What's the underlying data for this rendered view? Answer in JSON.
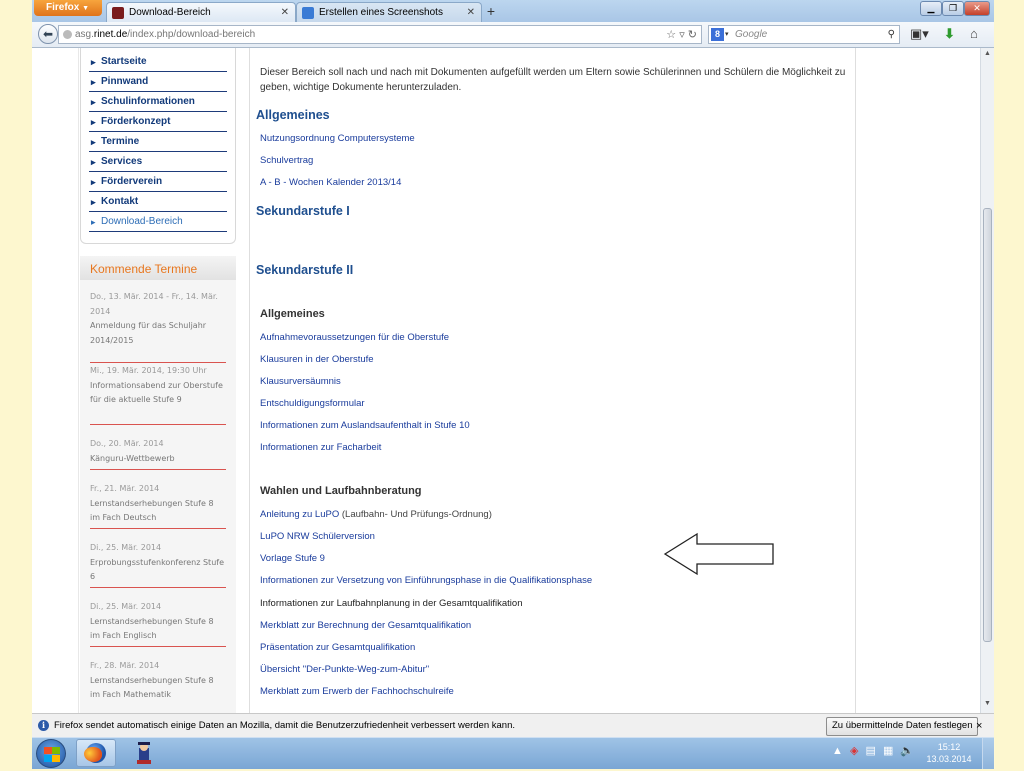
{
  "browser": {
    "app_button": "Firefox",
    "tabs": [
      {
        "label": "Download-Bereich",
        "active": true
      },
      {
        "label": "Erstellen eines Screenshots",
        "active": false
      }
    ],
    "new_tab": "+",
    "url_domain": "asg.rinet.de",
    "url_path": "/index.php/download-bereich",
    "url_prefix": "asg.",
    "url_host": "rinet.de",
    "search_placeholder": "Google",
    "search_engine_letter": "8"
  },
  "sidebar": {
    "menu": [
      {
        "label": "Startseite"
      },
      {
        "label": "Pinnwand"
      },
      {
        "label": "Schulinformationen"
      },
      {
        "label": "Förderkonzept"
      },
      {
        "label": "Termine"
      },
      {
        "label": "Services"
      },
      {
        "label": "Förderverein"
      },
      {
        "label": "Kontakt"
      },
      {
        "label": "Download-Bereich",
        "active": true
      }
    ],
    "events_title": "Kommende Termine",
    "events": [
      {
        "date": "Do., 13. Mär. 2014 - Fr., 14. Mär. 2014",
        "title": "Anmeldung für das Schuljahr 2014/2015"
      },
      {
        "date": "Mi., 19. Mär. 2014, 19:30 Uhr",
        "title": "Informationsabend zur Oberstufe für die aktuelle Stufe 9"
      },
      {
        "date": "Do., 20. Mär. 2014",
        "title": "Känguru-Wettbewerb"
      },
      {
        "date": "Fr., 21. Mär. 2014",
        "title": "Lernstandserhebungen Stufe 8 im Fach Deutsch"
      },
      {
        "date": "Di., 25. Mär. 2014",
        "title": "Erprobungsstufenkonferenz Stufe 6"
      },
      {
        "date": "Di., 25. Mär. 2014",
        "title": "Lernstandserhebungen Stufe 8 im Fach Englisch"
      },
      {
        "date": "Fr., 28. Mär. 2014",
        "title": "Lernstandserhebungen Stufe 8 im Fach Mathematik"
      }
    ]
  },
  "main": {
    "intro": "Dieser Bereich soll nach und nach mit Dokumenten aufgefüllt werden um Eltern sowie Schülerinnen und Schülern die Möglichkeit zu geben, wichtige Dokumente herunterzuladen.",
    "allgemeines_heading": "Allgemeines",
    "allgemeines_links": [
      "Nutzungsordnung Computersysteme",
      "Schulvertrag",
      "A - B - Wochen Kalender 2013/14"
    ],
    "sek1_heading": "Sekundarstufe I",
    "sek2_heading": "Sekundarstufe II",
    "sek2_allg_heading": "Allgemeines",
    "sek2_allg_links": [
      "Aufnahmevoraussetzungen für die Oberstufe",
      "Klausuren in der Oberstufe",
      "Klausurversäumnis",
      "Entschuldigungsformular",
      "Informationen zum Auslandsaufenthalt in Stufe 10",
      "Informationen zur Facharbeit"
    ],
    "wahlen_heading": "Wahlen und Laufbahnberatung",
    "lupo_link": "Anleitung zu LuPO",
    "lupo_suffix": " (Laufbahn- Und Prüfungs-Ordnung)",
    "wahlen_links": [
      "LuPO NRW Schülerversion",
      "Vorlage Stufe 9",
      "Informationen zur Versetzung von Einführungsphase in die Qualifikationsphase",
      "Informationen zur Laufbahnplanung in der Gesamtqualifikation",
      "Merkblatt zur Berechnung der Gesamtqualifikation",
      "Präsentation zur Gesamtqualifikation",
      "Übersicht \"Der-Punkte-Weg-zum-Abitur\"",
      "Merkblatt zum Erwerb der Fachhochschulreife"
    ]
  },
  "notification": {
    "message": "Firefox sendet automatisch einige Daten an Mozilla, damit die Benutzerzufriedenheit verbessert werden kann.",
    "button": "Zu übermittelnde Daten festlegen",
    "close": "×"
  },
  "taskbar": {
    "time": "15:12",
    "date": "13.03.2014"
  },
  "colors": {
    "link": "#1a3c9c",
    "heading": "#1f4f8f",
    "accent_orange": "#e8771f",
    "separator_red": "#d9534f"
  }
}
